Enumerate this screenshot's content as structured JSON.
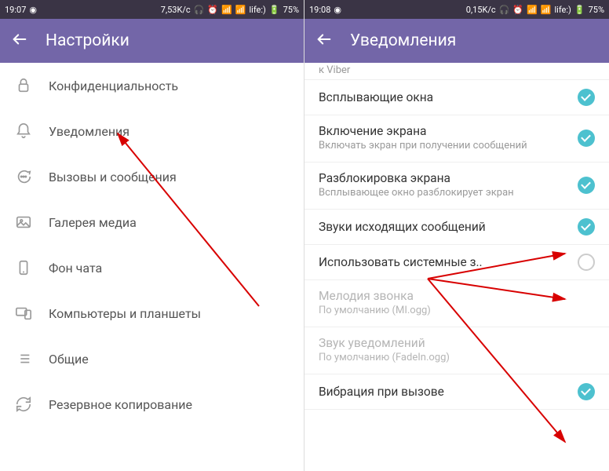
{
  "left": {
    "status": {
      "time": "19:07",
      "speed": "7,53K/c",
      "carrier": "life:)",
      "battery": "75%"
    },
    "header": {
      "title": "Настройки"
    },
    "items": [
      {
        "label": "Конфиденциальность",
        "icon": "lock"
      },
      {
        "label": "Уведомления",
        "icon": "bell"
      },
      {
        "label": "Вызовы и сообщения",
        "icon": "message"
      },
      {
        "label": "Галерея медиа",
        "icon": "image"
      },
      {
        "label": "Фон чата",
        "icon": "phone"
      },
      {
        "label": "Компьютеры и планшеты",
        "icon": "devices"
      },
      {
        "label": "Общие",
        "icon": "list"
      },
      {
        "label": "Резервное копирование",
        "icon": "refresh"
      }
    ]
  },
  "right": {
    "status": {
      "time": "19:08",
      "speed": "0,15K/c",
      "carrier": "life:)",
      "battery": "75%"
    },
    "header": {
      "title": "Уведомления"
    },
    "scroll_hint": "к Viber",
    "items": [
      {
        "title": "Всплывающие окна",
        "sub": "",
        "checked": true,
        "enabled": true
      },
      {
        "title": "Включение экрана",
        "sub": "Включать экран при получении сообщений",
        "checked": true,
        "enabled": true
      },
      {
        "title": "Разблокировка экрана",
        "sub": "Всплывающее окно разблокирует экран",
        "checked": true,
        "enabled": true
      },
      {
        "title": "Звуки исходящих сообщений",
        "sub": "",
        "checked": true,
        "enabled": true
      },
      {
        "title": "Использовать системные з..",
        "sub": "",
        "checked": false,
        "enabled": true
      },
      {
        "title": "Мелодия звонка",
        "sub": "По умолчанию (MI.ogg)",
        "checked": null,
        "enabled": false
      },
      {
        "title": "Звук уведомлений",
        "sub": "По умолчанию (FadeIn.ogg)",
        "checked": null,
        "enabled": false
      },
      {
        "title": "Вибрация при вызове",
        "sub": "",
        "checked": true,
        "enabled": true
      }
    ]
  }
}
